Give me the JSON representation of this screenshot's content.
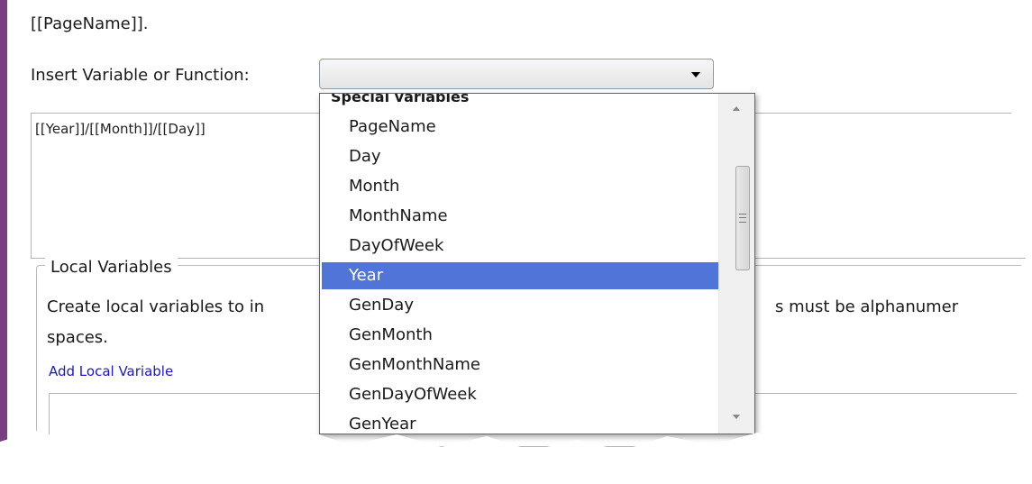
{
  "header": {
    "page_name_text": "[[PageName]]."
  },
  "insert": {
    "label": "Insert Variable or Function:",
    "selected_value": ""
  },
  "expression": {
    "value": "[[Year]]/[[Month]]/[[Day]]"
  },
  "local_variables": {
    "legend": "Local Variables",
    "description_start": "Create local variables to in",
    "description_end": "s must be alphanumer",
    "description_line2": "spaces.",
    "add_link": "Add Local Variable"
  },
  "dropdown": {
    "group_label": "Special variables",
    "items": [
      {
        "label": "PageName",
        "selected": false
      },
      {
        "label": "Day",
        "selected": false
      },
      {
        "label": "Month",
        "selected": false
      },
      {
        "label": "MonthName",
        "selected": false
      },
      {
        "label": "DayOfWeek",
        "selected": false
      },
      {
        "label": "Year",
        "selected": true
      },
      {
        "label": "GenDay",
        "selected": false
      },
      {
        "label": "GenMonth",
        "selected": false
      },
      {
        "label": "GenMonthName",
        "selected": false
      },
      {
        "label": "GenDayOfWeek",
        "selected": false
      },
      {
        "label": "GenYear",
        "selected": false
      }
    ],
    "selection_color": "#5074d7"
  },
  "theme": {
    "accent": "#7a3d84",
    "link": "#1a14d9"
  }
}
